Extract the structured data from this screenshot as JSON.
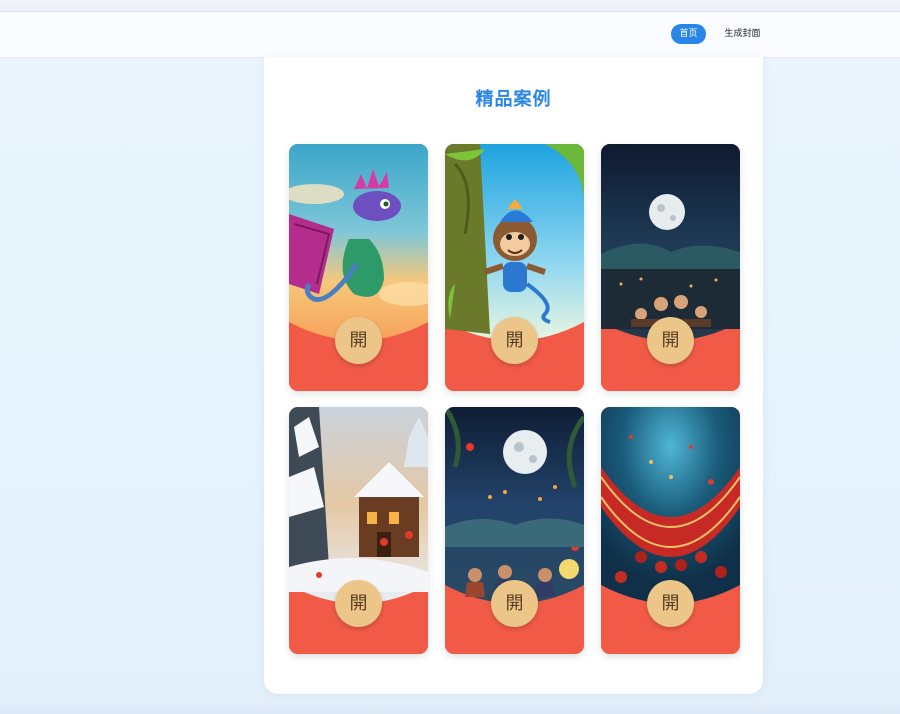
{
  "nav": {
    "home_label": "首页",
    "generate_label": "生成封面"
  },
  "main": {
    "title": "精品案例",
    "cards": [
      {
        "theme": "purple-dragon",
        "open_label": "開"
      },
      {
        "theme": "blue-monkey",
        "open_label": "開"
      },
      {
        "theme": "full-moon-family-dinner",
        "open_label": "開"
      },
      {
        "theme": "snowy-village",
        "open_label": "開"
      },
      {
        "theme": "moon-lantern-reunion",
        "open_label": "開"
      },
      {
        "theme": "red-festive-confetti",
        "open_label": "開"
      }
    ]
  },
  "colors": {
    "accent": "#2a86e6",
    "envelope_red": "#f05a47",
    "badge_gold": "#ecc688"
  }
}
